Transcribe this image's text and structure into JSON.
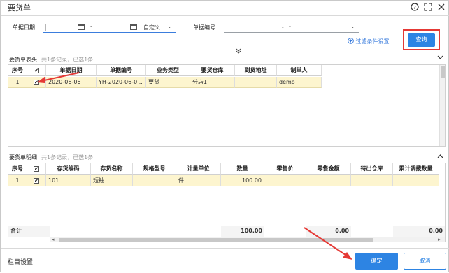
{
  "window": {
    "title": "要货单",
    "icons": [
      "help-icon",
      "fullscreen-icon",
      "close-icon"
    ]
  },
  "filters": {
    "date_label": "单据日期",
    "date_from": "",
    "date_sep": "-",
    "date_to": "",
    "date_mode": "自定义",
    "code_label": "单据编号",
    "code_sep": "-",
    "advanced_link": "过滤条件设置",
    "query_button": "查询"
  },
  "header_section": {
    "title": "要货单表头",
    "summary": "共1条记录，已选1条",
    "columns": [
      "序号",
      "",
      "单据日期",
      "单据编号",
      "业务类型",
      "要货仓库",
      "到货地址",
      "制单人"
    ],
    "rows": [
      [
        "1",
        "✔",
        "2020-06-06",
        "YH-2020-06-0...",
        "要货",
        "分店1",
        "",
        "demo"
      ]
    ]
  },
  "detail_section": {
    "title": "要货单明细",
    "summary": "共1条记录，已选1条",
    "columns": [
      "序号",
      "",
      "存货编码",
      "存货名称",
      "规格型号",
      "计量单位",
      "数量",
      "零售价",
      "零售金额",
      "待出仓库",
      "累计调拨数量"
    ],
    "rows": [
      [
        "1",
        "✔",
        "101",
        "短袖",
        "",
        "件",
        "100.00",
        "",
        "",
        "",
        ""
      ]
    ],
    "total": {
      "label": "合计",
      "quantity": "100.00",
      "amount": "0.00",
      "transfer": "0.00"
    }
  },
  "footer": {
    "column_settings": "栏目设置",
    "confirm_button": "确定",
    "cancel_button": "取消"
  },
  "colors": {
    "accent": "#2d84e3",
    "highlight_row": "#fdf5cf",
    "annotation_red": "#e53935"
  }
}
